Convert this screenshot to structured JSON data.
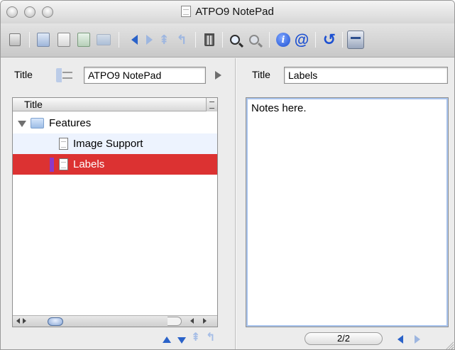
{
  "window": {
    "title": "ATPO9 NotePad"
  },
  "toolbar": {
    "buttons": [
      "new-window-icon",
      "new-card-icon",
      "new-note-icon",
      "new-child-icon",
      "new-folder-icon",
      "back-icon",
      "forward-icon",
      "outdent-icon",
      "indent-icon",
      "trash-icon",
      "find-icon",
      "find-next-icon",
      "info-icon",
      "email-icon",
      "refresh-icon",
      "stamp-icon"
    ]
  },
  "left": {
    "title_label": "Title",
    "title_value": "ATPO9 NotePad",
    "outline_header": "Title",
    "rows": [
      {
        "label": "Features",
        "type": "folder",
        "expanded": true
      },
      {
        "label": "Image Support",
        "type": "note"
      },
      {
        "label": "Labels",
        "type": "note",
        "selected": true,
        "label_color": "#8c3ac8"
      }
    ]
  },
  "right": {
    "title_label": "Title",
    "title_value": "Labels",
    "notes_text": "Notes here.",
    "pager": "2/2"
  },
  "colors": {
    "selection": "#dc3232",
    "accent_blue": "#2a62c9",
    "focus_ring": "#a9c4ee"
  }
}
